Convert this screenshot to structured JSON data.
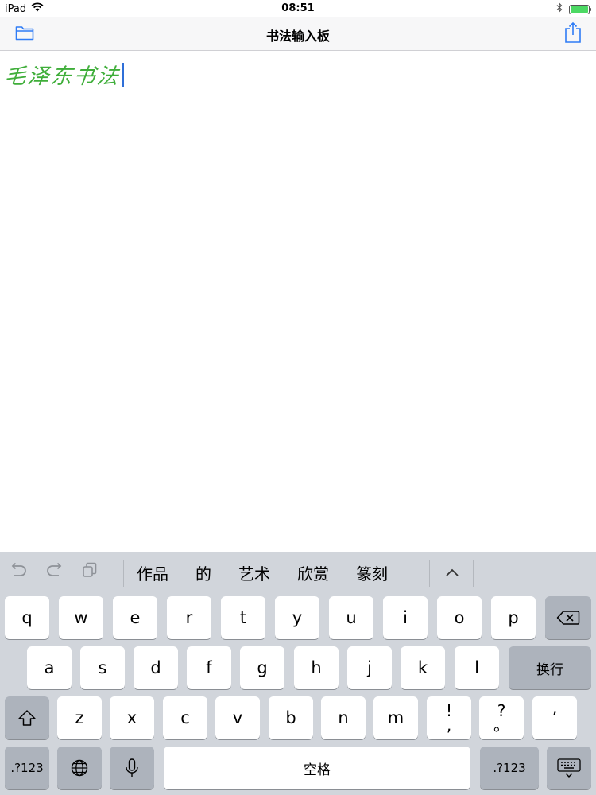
{
  "status_bar": {
    "device": "iPad",
    "time": "08:51"
  },
  "nav": {
    "title": "书法输入板",
    "left_icon": "folder-icon",
    "right_icon": "share-icon"
  },
  "editor": {
    "text": "毛泽东书法",
    "text_color": "#3fae3a"
  },
  "keyboard": {
    "tools": [
      "undo-icon",
      "redo-icon",
      "copy-icon"
    ],
    "candidates": [
      "作品",
      "的",
      "艺术",
      "欣赏",
      "篆刻"
    ],
    "row1": [
      "q",
      "w",
      "e",
      "r",
      "t",
      "y",
      "u",
      "i",
      "o",
      "p"
    ],
    "row2": [
      "a",
      "s",
      "d",
      "f",
      "g",
      "h",
      "j",
      "k",
      "l"
    ],
    "return_label": "换行",
    "row3": [
      "z",
      "x",
      "c",
      "v",
      "b",
      "n",
      "m"
    ],
    "punct1": {
      "top": "!",
      "bottom": ","
    },
    "punct2": {
      "top": "?",
      "bottom": "。"
    },
    "punct3": "’",
    "numbers_label": ".?123",
    "space_label": "空格",
    "numbers_label_right": ".?123"
  }
}
